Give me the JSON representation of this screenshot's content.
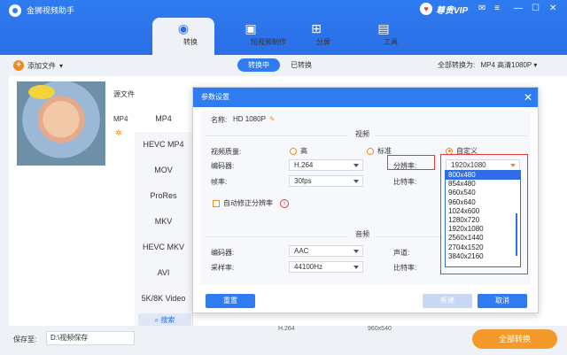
{
  "app": {
    "title": "金狮视频助手",
    "vip_label": "尊贵VIP"
  },
  "nav": [
    {
      "label": "转换",
      "icon": "convert-icon"
    },
    {
      "label": "短视频制作",
      "icon": "tv-icon"
    },
    {
      "label": "分屏",
      "icon": "split-screen-icon"
    },
    {
      "label": "工具",
      "icon": "toolbox-icon"
    }
  ],
  "toolbar": {
    "add_file": "添加文件",
    "tab_converting": "转换中",
    "tab_converted": "已转换",
    "convert_all_label": "全部转换为:",
    "convert_all_value": "MP4 高清1080P"
  },
  "file": {
    "source_label": "源文件",
    "format_label": "MP4"
  },
  "formats": [
    "MP4",
    "HEVC MP4",
    "MOV",
    "ProRes",
    "MKV",
    "HEVC MKV",
    "AVI",
    "5K/8K Video"
  ],
  "format_search": "搜索",
  "bottom": {
    "save_label": "保存至:",
    "save_path": "D:\\视频保存",
    "convert_button": "全部转换",
    "peek_codec": "H.264",
    "peek_res": "960x540"
  },
  "dialog": {
    "title": "参数设置",
    "name_label": "名称:",
    "name_value": "HD 1080P",
    "video_section": "视频",
    "quality_label": "视频质量:",
    "quality_high": "高",
    "quality_standard": "标准",
    "quality_custom": "自定义",
    "encoder_label": "编码器:",
    "encoder_value": "H.264",
    "resolution_label": "分辨率:",
    "resolution_value": "1920x1080",
    "framerate_label": "帧率:",
    "framerate_value": "30fps",
    "bitrate_label": "比特率:",
    "auto_fix_label": "自动修正分辨率",
    "audio_section": "音频",
    "audio_encoder_label": "编码器:",
    "audio_encoder_value": "AAC",
    "channel_label": "声道:",
    "samplerate_label": "采样率:",
    "samplerate_value": "44100Hz",
    "audio_bitrate_label": "比特率:",
    "reset_button": "重置",
    "new_button": "新建",
    "cancel_button": "取消"
  },
  "resolution_options": [
    "800x480",
    "854x480",
    "960x540",
    "960x640",
    "1024x600",
    "1280x720",
    "1920x1080",
    "2560x1440",
    "2704x1520",
    "3840x2160"
  ],
  "colors": {
    "accent": "#2f7bf0",
    "orange": "#f08a1c",
    "highlight_red": "#e5383b"
  }
}
